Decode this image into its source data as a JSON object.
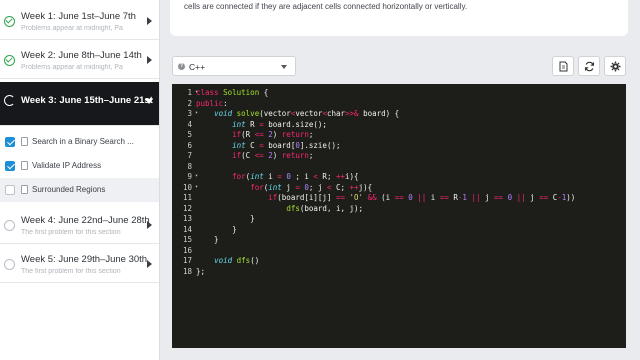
{
  "sidebar": {
    "weeks": [
      {
        "title": "Week 1: June 1st–June 7th",
        "subtitle": "Problems appear at midnight, Pa",
        "state": "done"
      },
      {
        "title": "Week 2: June 8th–June 14th",
        "subtitle": "Problems appear at midnight, Pa",
        "state": "done"
      },
      {
        "title": "Week 3: June 15th–June 21st",
        "subtitle": "",
        "state": "active"
      },
      {
        "title": "Week 4: June 22nd–June 28th",
        "subtitle": "The first problem for this section",
        "state": "todo"
      },
      {
        "title": "Week 5: June 29th–June 30th",
        "subtitle": "The first problem for this section",
        "state": "todo"
      }
    ],
    "problems": [
      {
        "title": "Search in a Binary Search ...",
        "checked": true
      },
      {
        "title": "Validate IP Address",
        "checked": true
      },
      {
        "title": "Surrounded Regions",
        "checked": false
      }
    ]
  },
  "problem": {
    "description_fragment": "cells are connected if they are adjacent cells connected horizontally or vertically."
  },
  "toolbar": {
    "language": "C++",
    "buttons": [
      "file-icon",
      "refresh-icon",
      "settings-icon"
    ]
  },
  "editor": {
    "line_numbers": [
      "1",
      "2",
      "3",
      "4",
      "5",
      "6",
      "7",
      "8",
      "9",
      "10",
      "11",
      "12",
      "13",
      "14",
      "15",
      "16",
      "17",
      "18"
    ],
    "folded_lines": [
      "1",
      "3",
      "9",
      "10"
    ],
    "lines": [
      "class Solution {",
      "public:",
      "    void solve(vector<vector<char>>& board) {",
      "        int R = board.size();",
      "        if(R <= 2) return;",
      "        int C = board[0].szie();",
      "        if(C <= 2) return;",
      "",
      "        for(int i = 0 ; i < R; ++i){",
      "            for(int j = 0; j < C; ++j){",
      "                if(board[i][j] == 'O' && (i == 0 || i == R-1 || j == 0 || j == C-1))",
      "                    dfs(board, i, j);",
      "            }",
      "        }",
      "    }",
      "",
      "    void dfs()",
      "};"
    ]
  },
  "colors": {
    "editor_bg": "#1d1e19",
    "active_week_bg": "#16181b",
    "check_green": "#2ea44f",
    "checkbox_blue": "#1c8fd6"
  }
}
